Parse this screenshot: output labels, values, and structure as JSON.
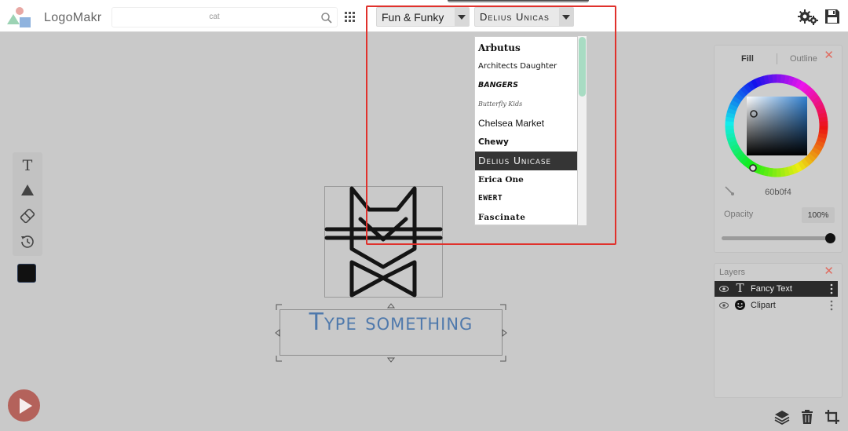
{
  "app": {
    "name": "LogoMakr"
  },
  "search": {
    "value": "cat"
  },
  "category_dropdown": {
    "selected": "Fun & Funky"
  },
  "font_dropdown": {
    "selected": "Delius Unicas",
    "options": [
      "Arbutus",
      "Architects Daughter",
      "BANGERS",
      "Butterfly Kids",
      "Chelsea Market",
      "Chewy",
      "Delius Unicase",
      "Erica One",
      "EWERT",
      "Fascinate"
    ],
    "highlighted_index": 6,
    "highlight_color": "#e0312c"
  },
  "canvas": {
    "text_element": {
      "value": "Type something",
      "color": "#4f79ac"
    },
    "clipart": {
      "icon": "cat-icon"
    }
  },
  "color_panel": {
    "tabs": [
      "Fill",
      "Outline"
    ],
    "active_tab": "Fill",
    "hex_value": "60b0f4",
    "opacity_label": "Opacity",
    "opacity_value": "100%",
    "opacity_fraction": 1.0
  },
  "layers_panel": {
    "title": "Layers",
    "layers": [
      {
        "label": "Fancy Text",
        "icon": "text-icon",
        "selected": true
      },
      {
        "label": "Clipart",
        "icon": "smiley-icon",
        "selected": false
      }
    ]
  },
  "colors": {
    "swatch": "#111111",
    "accent": "#a8dcc3",
    "close": "#e06b5f"
  }
}
